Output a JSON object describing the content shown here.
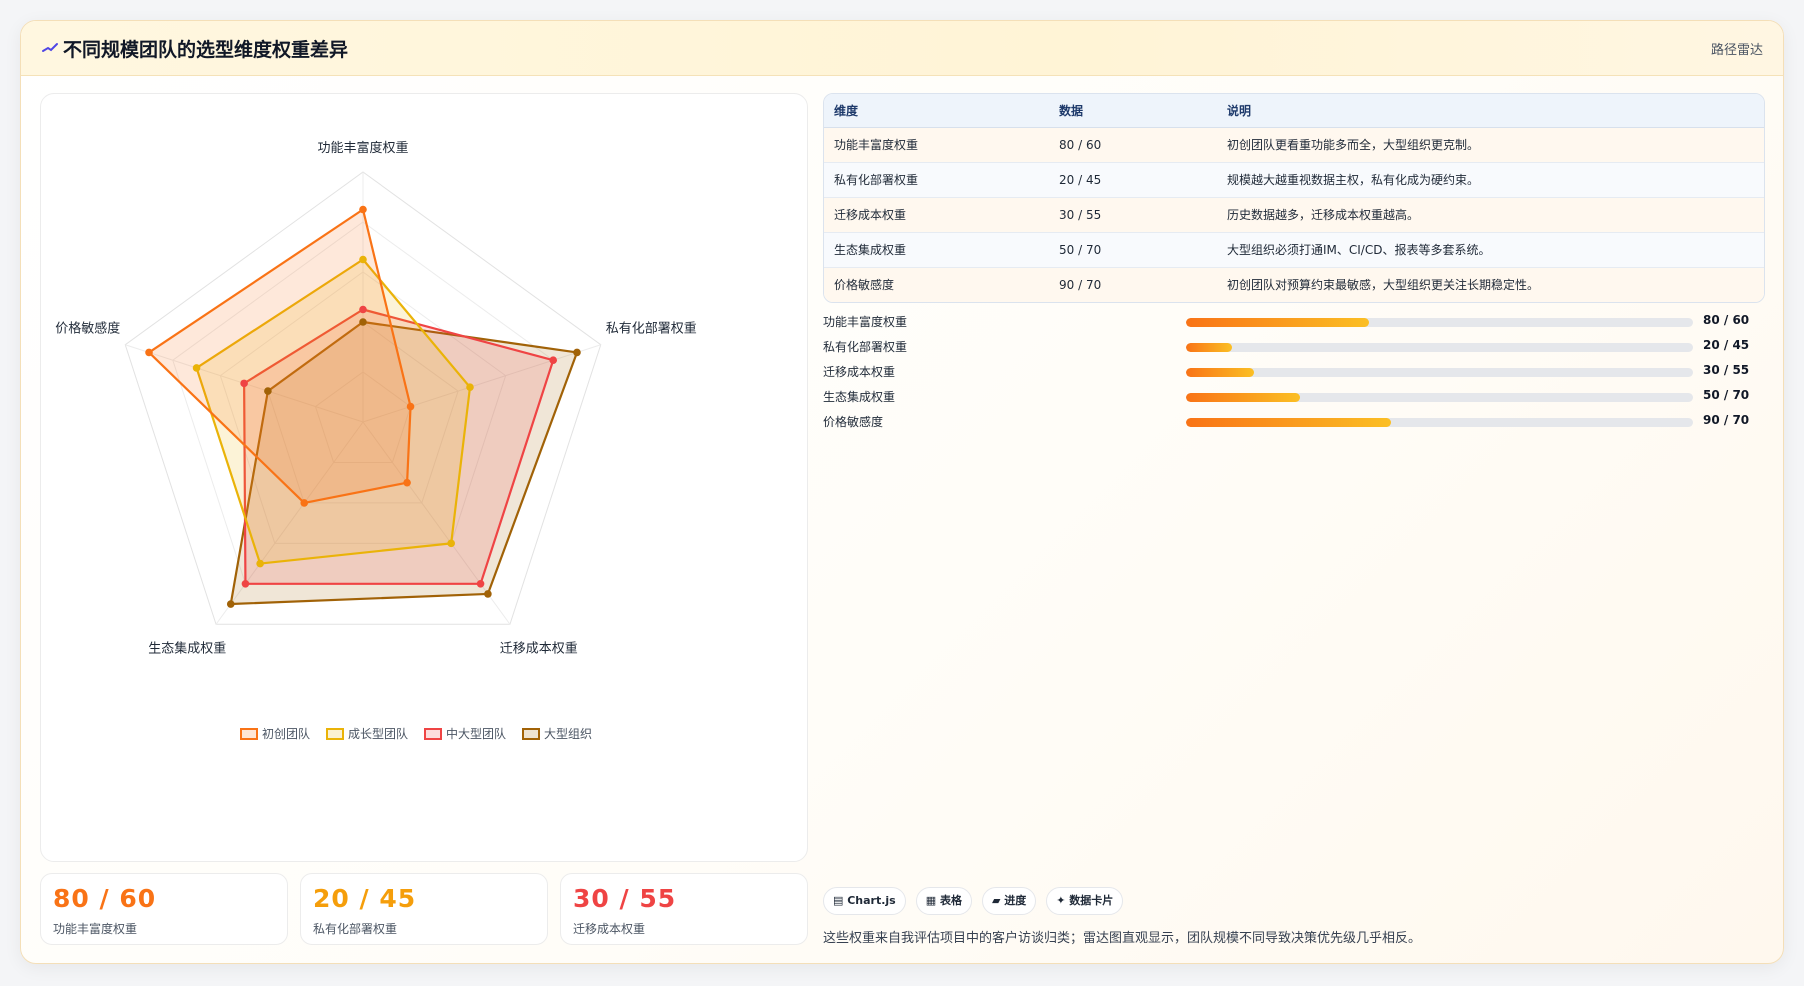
{
  "header": {
    "title": "不同规模团队的选型维度权重差异",
    "right_link": "路径雷达"
  },
  "chart_data": {
    "type": "radar",
    "axes": [
      "功能丰富度权重",
      "私有化部署权重",
      "迁移成本权重",
      "生态集成权重",
      "价格敏感度"
    ],
    "range": [
      0,
      100
    ],
    "series": [
      {
        "name": "初创团队",
        "values": [
          85,
          20,
          30,
          40,
          90
        ],
        "color": "#f97316"
      },
      {
        "name": "成长型团队",
        "values": [
          65,
          45,
          60,
          70,
          70
        ],
        "color": "#eab308"
      },
      {
        "name": "中大型团队",
        "values": [
          45,
          80,
          80,
          80,
          50
        ],
        "color": "#ef4444"
      },
      {
        "name": "大型组织",
        "values": [
          40,
          90,
          85,
          90,
          40
        ],
        "color": "#a16207"
      }
    ],
    "legend_position": "bottom"
  },
  "kpis": [
    {
      "value": "80 / 60",
      "label": "功能丰富度权重",
      "color": "#f97316"
    },
    {
      "value": "20 / 45",
      "label": "私有化部署权重",
      "color": "#f59e0b"
    },
    {
      "value": "30 / 55",
      "label": "迁移成本权重",
      "color": "#ef4444"
    }
  ],
  "table": {
    "headers": [
      "维度",
      "数据",
      "说明"
    ],
    "rows": [
      [
        "功能丰富度权重",
        "80 / 60",
        "初创团队更看重功能多而全，大型组织更克制。"
      ],
      [
        "私有化部署权重",
        "20 / 45",
        "规模越大越重视数据主权，私有化成为硬约束。"
      ],
      [
        "迁移成本权重",
        "30 / 55",
        "历史数据越多，迁移成本权重越高。"
      ],
      [
        "生态集成权重",
        "50 / 70",
        "大型组织必须打通IM、CI/CD、报表等多套系统。"
      ],
      [
        "价格敏感度",
        "90 / 70",
        "初创团队对预算约束最敏感，大型组织更关注长期稳定性。"
      ]
    ]
  },
  "progress": [
    {
      "label": "功能丰富度权重",
      "value": "80 / 60",
      "fraction": 0.36
    },
    {
      "label": "私有化部署权重",
      "value": "20 / 45",
      "fraction": 0.09
    },
    {
      "label": "迁移成本权重",
      "value": "30 / 55",
      "fraction": 0.135
    },
    {
      "label": "生态集成权重",
      "value": "50 / 70",
      "fraction": 0.225
    },
    {
      "label": "价格敏感度",
      "value": "90 / 70",
      "fraction": 0.405
    }
  ],
  "chips": [
    "▤ Chart.js",
    "▦ 表格",
    "▰ 进度",
    "✦ 数据卡片"
  ],
  "note": "这些权重来自我评估项目中的客户访谈归类；雷达图直观显示，团队规模不同导致决策优先级几乎相反。"
}
